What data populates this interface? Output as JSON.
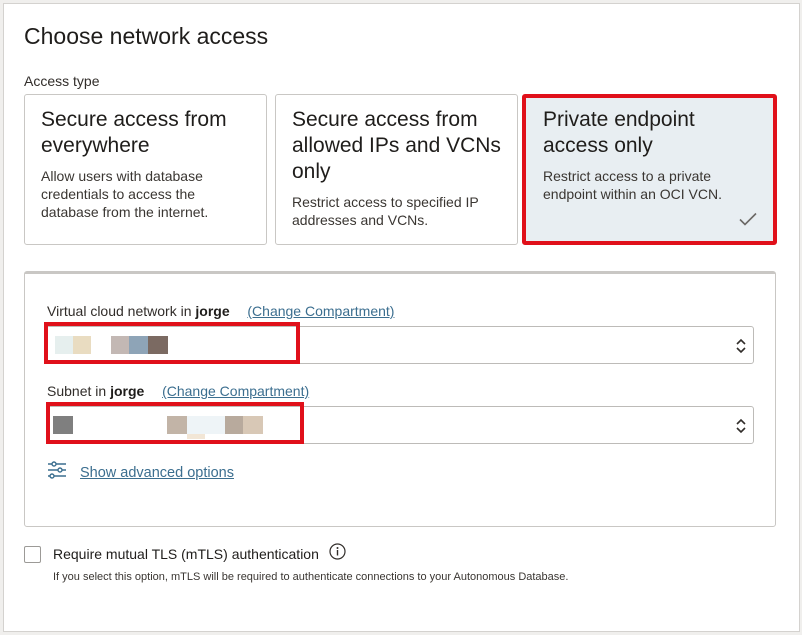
{
  "page": {
    "title": "Choose network access",
    "access_type_label": "Access type"
  },
  "access_options": [
    {
      "title": "Secure access from everywhere",
      "description": "Allow users with database credentials to access the database from the internet.",
      "selected": false
    },
    {
      "title": "Secure access from allowed IPs and VCNs only",
      "description": "Restrict access to specified IP addresses and VCNs.",
      "selected": false
    },
    {
      "title": "Private endpoint access only",
      "description": "Restrict access to a private endpoint within an OCI VCN.",
      "selected": true
    }
  ],
  "vcn": {
    "label_prefix": "Virtual cloud network in",
    "compartment": "jorge",
    "change_link": "(Change Compartment)"
  },
  "subnet": {
    "label_prefix": "Subnet in",
    "compartment": "jorge",
    "change_link": "(Change Compartment)"
  },
  "advanced_link": "Show advanced options",
  "mtls": {
    "label": "Require mutual TLS (mTLS) authentication",
    "checked": false,
    "helper": "If you select this option, mTLS will be required to authenticate connections to your Autonomous Database."
  },
  "colors": {
    "highlight_red": "#e0101a",
    "selected_bg": "#e8eef2",
    "link": "#3b6e8f"
  }
}
